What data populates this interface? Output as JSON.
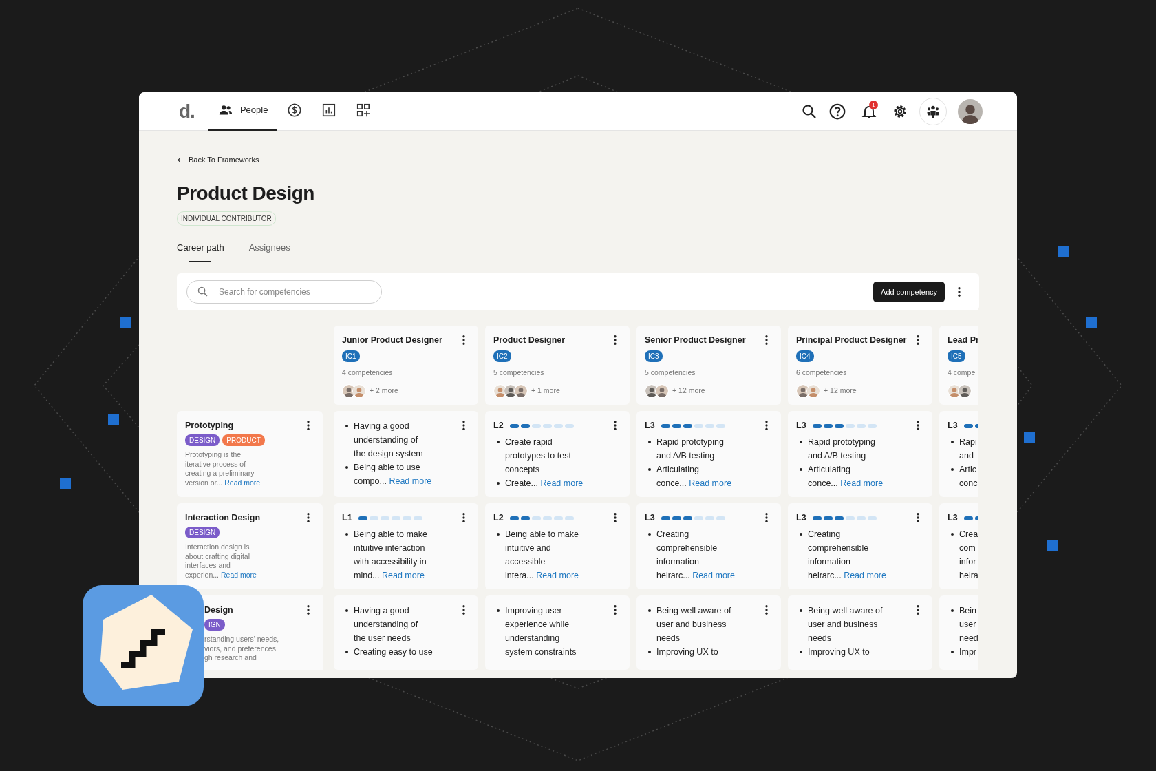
{
  "nav": {
    "logo": "d.",
    "tabs": [
      {
        "label": "People",
        "selected": true
      },
      {
        "selected": false
      },
      {
        "selected": false
      },
      {
        "selected": false
      }
    ],
    "notification_count": "1"
  },
  "back_link": "Back To Frameworks",
  "title": "Product Design",
  "track_tag": "INDIVIDUAL CONTRIBUTOR",
  "page_tabs": [
    {
      "label": "Career path",
      "selected": true
    },
    {
      "label": "Assignees",
      "selected": false
    }
  ],
  "search": {
    "placeholder": "Search for competencies"
  },
  "add_button": "Add competency",
  "columns": [
    {
      "kind": "full",
      "title": "Junior Product Designer",
      "code": "IC1",
      "count": "4 competencies",
      "more": "+ 2 more"
    },
    {
      "kind": "full",
      "title": "Product Designer",
      "code": "IC2",
      "count": "5 competencies",
      "more": "+ 1 more"
    },
    {
      "kind": "full",
      "title": "Senior Product Designer",
      "code": "IC3",
      "count": "5 competencies",
      "more": "+ 12 more"
    },
    {
      "kind": "full",
      "title": "Principal Product Designer",
      "code": "IC4",
      "count": "6 competencies",
      "more": "+ 12 more"
    },
    {
      "kind": "partial",
      "title": "Lead Pr",
      "code": "IC5",
      "count": "4 compe"
    }
  ],
  "rows": [
    {
      "kind": "full",
      "title": "Prototyping",
      "tags": [
        {
          "label": "DESIGN",
          "color": "#7b5cc9"
        },
        {
          "label": "PRODUCT",
          "color": "#f2784b"
        }
      ],
      "description": [
        "Prototyping is the",
        "iterative process of",
        "creating a preliminary",
        "version or..."
      ],
      "read_more": "Read more",
      "cells": [
        {
          "items": [
            [
              "Having a good",
              "understanding of",
              "the design system"
            ],
            [
              "Being able to use",
              "compo..."
            ]
          ],
          "read_more": "Read more"
        },
        {
          "level_label": "L2",
          "level": 0.333,
          "items": [
            [
              "Create rapid",
              "prototypes to test",
              "concepts"
            ],
            [
              "Create..."
            ]
          ],
          "read_more": "Read more"
        },
        {
          "level_label": "L3",
          "level": 0.5,
          "items": [
            [
              "Rapid prototyping",
              "and A/B testing"
            ],
            [
              "Articulating",
              "conce..."
            ]
          ],
          "read_more": "Read more"
        },
        {
          "level_label": "L3",
          "level": 0.5,
          "items": [
            [
              "Rapid prototyping",
              "and A/B testing"
            ],
            [
              "Articulating",
              "conce..."
            ]
          ],
          "read_more": "Read more"
        },
        {
          "level_label": "L3",
          "level": 0.5,
          "items": [
            [
              "Rapi",
              "and"
            ],
            [
              "Artic",
              "conc"
            ]
          ]
        }
      ]
    },
    {
      "kind": "full",
      "title": "Interaction Design",
      "tags": [
        {
          "label": "DESIGN",
          "color": "#7b5cc9"
        }
      ],
      "description": [
        "Interaction design is",
        "about crafting digital",
        "interfaces and",
        "experien..."
      ],
      "read_more": "Read more",
      "cells": [
        {
          "level_label": "L1",
          "level": 0.167,
          "items": [
            [
              "Being able to make",
              "intuitive interaction",
              "with accessibility in",
              "mind..."
            ]
          ],
          "read_more": "Read more"
        },
        {
          "level_label": "L2",
          "level": 0.333,
          "items": [
            [
              "Being able to make",
              "intuitive and",
              "accessible",
              "intera..."
            ]
          ],
          "read_more": "Read more"
        },
        {
          "level_label": "L3",
          "level": 0.5,
          "items": [
            [
              "Creating",
              "comprehensible",
              "information",
              "heirarc..."
            ]
          ],
          "read_more": "Read more"
        },
        {
          "level_label": "L3",
          "level": 0.5,
          "items": [
            [
              "Creating",
              "comprehensible",
              "information",
              "heirarc..."
            ]
          ],
          "read_more": "Read more"
        },
        {
          "level_label": "L3",
          "level": 0.5,
          "items": [
            [
              "Crea",
              "com",
              "infor",
              "heira"
            ]
          ]
        }
      ]
    },
    {
      "kind": "partial",
      "title": "Design",
      "tags": [
        {
          "label": "IGN",
          "color": "#7b5cc9"
        }
      ],
      "description": [
        "rstanding users' needs,",
        "viors, and preferences",
        "gh research and"
      ],
      "cells": [
        {
          "items": [
            [
              "Having a good",
              "understanding of",
              "the user needs"
            ],
            [
              "Creating easy to use"
            ]
          ]
        },
        {
          "items": [
            [
              "Improving user",
              "experience while",
              "understanding",
              "system constraints"
            ]
          ]
        },
        {
          "items": [
            [
              "Being well aware of",
              "user and business",
              "needs"
            ],
            [
              "Improving UX to"
            ]
          ]
        },
        {
          "items": [
            [
              "Being well aware of",
              "user and business",
              "needs"
            ],
            [
              "Improving UX to"
            ]
          ]
        },
        {
          "items": [
            [
              "Bein",
              "user",
              "need"
            ],
            [
              "Impr"
            ]
          ]
        }
      ]
    }
  ]
}
